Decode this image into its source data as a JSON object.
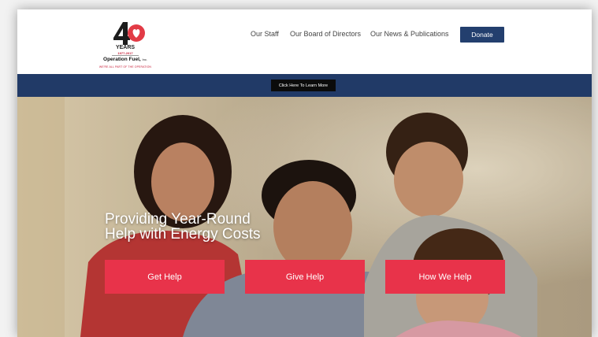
{
  "logo": {
    "number": "40",
    "years": "YEARS",
    "dates": "1977-2017",
    "org_name": "Operation Fuel,",
    "org_suffix": "Inc.",
    "tagline": "WE'RE ALL PART OF THE OPERATION"
  },
  "nav": {
    "items": [
      "Our Staff",
      "Our Board of Directors",
      "Our News & Publications"
    ],
    "donate_label": "Donate"
  },
  "banner": {
    "button_label": "Click Here To Learn More"
  },
  "hero": {
    "headline_line1": "Providing Year-Round",
    "headline_line2": "Help with Energy Costs",
    "buttons": [
      "Get Help",
      "Give Help",
      "How We Help"
    ]
  },
  "colors": {
    "brand_red": "#e8334a",
    "navy": "#233f6e",
    "banner": "#213a67"
  }
}
